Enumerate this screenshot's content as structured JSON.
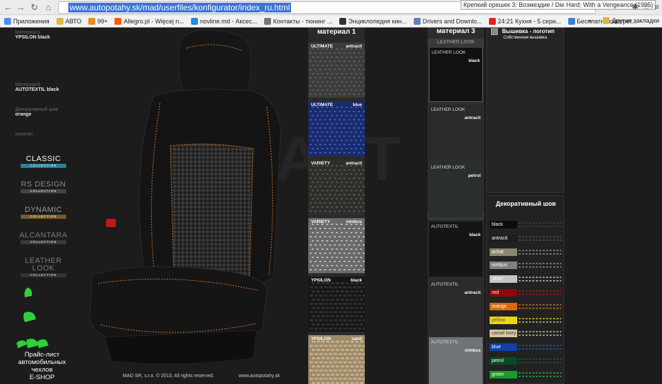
{
  "browser": {
    "url": "www.autopotahy.sk/mad/userfiles/konfigurator/index_ru.html",
    "tooltip": "Крепкий орешек 3: Возмездие / Die Hard: With a Vengeance (1995)",
    "bookmarks": [
      {
        "label": "Приложения",
        "color": "#4a8ef0"
      },
      {
        "label": "АВТО",
        "color": "#e2b640"
      },
      {
        "label": "99+",
        "color": "#f08b1d"
      },
      {
        "label": "Allegro.pl - Więcej n...",
        "color": "#ff5a00"
      },
      {
        "label": "novline.md - Аксес...",
        "color": "#1e88e5"
      },
      {
        "label": "Контакты - тюнинг ...",
        "color": "#777777"
      },
      {
        "label": "Энциклопедия кин...",
        "color": "#333333"
      },
      {
        "label": "Drivers and Downlo...",
        "color": "#5f7fbf"
      },
      {
        "label": "24:21 Кухня - 5 сери...",
        "color": "#e62117"
      },
      {
        "label": "Бесплатно смотрет...",
        "color": "#3a7de0"
      }
    ],
    "bookmarks_more": "»",
    "other_bookmarks": "Другие закладки"
  },
  "left_info": [
    {
      "label": "Материал1",
      "value": "YPSILON black"
    },
    {
      "label": "Материал3",
      "value": "AUTOTEXTIL black"
    },
    {
      "label": "Декоративный шов",
      "value": "orange"
    },
    {
      "label": "логотип",
      "value": ""
    }
  ],
  "collections": [
    {
      "name": "CLASSIC",
      "sub": "COLLECTION",
      "name_color": "#ffffff",
      "bar_color": "#2c7f9a"
    },
    {
      "name": "RS DESIGN",
      "sub": "COLLECTION",
      "name_color": "#8a8a8a",
      "bar_color": "#444444"
    },
    {
      "name": "DYNAMIC",
      "sub": "COLLECTION",
      "name_color": "#9a9a9a",
      "bar_color": "#7a5a2a"
    },
    {
      "name": "ALCANTARA",
      "sub": "COLLECTION",
      "name_color": "#7a7a7a",
      "bar_color": "#3a3a3a"
    },
    {
      "name": "LEATHER LOOK",
      "sub": "COLLECTION",
      "name_color": "#7a7a7a",
      "bar_color": "#333333"
    }
  ],
  "price_link": {
    "line1": "Прайс-лист",
    "line2": "автомобильных",
    "line3": "чехлов",
    "line4": "E-SHOP"
  },
  "footer": {
    "copyright": "MAD SR, s.r.o. © 2013, All rights reserved.",
    "url": "www.autopotahy.sk"
  },
  "material1": {
    "title": "материал 1",
    "swatches": [
      {
        "name": "ULTIMATE",
        "color": "antracit",
        "bg": "#3c3c3c",
        "pattern": "#5a5a5a"
      },
      {
        "name": "ULTIMATE",
        "color": "blue",
        "bg": "#1a2b6e",
        "pattern": "#3a5ab0"
      },
      {
        "name": "VARIETY",
        "color": "antracit",
        "bg": "#2e2e2a",
        "pattern": "#55554a"
      },
      {
        "name": "VARIETY",
        "color": "nimbus",
        "bg": "#6a6a6a",
        "pattern": "#b5b5b5"
      },
      {
        "name": "YPSILON",
        "color": "black",
        "bg": "#161616",
        "pattern": "#2e2e2e"
      },
      {
        "name": "YPSILON",
        "color": "sand",
        "bg": "#9c8a6a",
        "pattern": "#c2ad88"
      }
    ]
  },
  "material3": {
    "title": "материал 3",
    "leather_header": "LEATHER LOOK",
    "autotextil_header": "AUTOTEXTIL",
    "leather": [
      {
        "name": "LEATHER LOOK",
        "color": "black",
        "bg": "#111111"
      },
      {
        "name": "LEATHER LOOK",
        "color": "antracit",
        "bg": "#2a2a2a"
      },
      {
        "name": "LEATHER LOOK",
        "color": "petrol",
        "bg": "#2a2f2c"
      }
    ],
    "autotextil": [
      {
        "name": "AUTOTEXTIL",
        "color": "black",
        "bg": "#151515"
      },
      {
        "name": "AUTOTEXTIL",
        "color": "antracit",
        "bg": "#2b2b2b"
      },
      {
        "name": "AUTOTEXTIL",
        "color": "nimbus",
        "bg": "#6f7276"
      }
    ]
  },
  "logo_option": {
    "title": "Вышивка - логотип",
    "sub": "Собственная вышивка"
  },
  "stitching": {
    "title": "Декоративный шов",
    "items": [
      {
        "label": "black",
        "bg": "#0c0c0c",
        "text": "#ffffff",
        "line": "#444444"
      },
      {
        "label": "antracit",
        "bg": "#1e1e1e",
        "text": "#ffffff",
        "line": "#5a5a5a"
      },
      {
        "label": "achat",
        "bg": "#8a8670",
        "text": "#ffffff",
        "line": "#a8a48a"
      },
      {
        "label": "nimbus",
        "bg": "#808080",
        "text": "#ffffff",
        "line": "#a0a0a0"
      },
      {
        "label": "silver",
        "bg": "#c4c4c4",
        "text": "#ffffff",
        "line": "#dcdcdc"
      },
      {
        "label": "red",
        "bg": "#8a0a0a",
        "text": "#ffffff",
        "line": "#c01818"
      },
      {
        "label": "orange",
        "bg": "#d86a12",
        "text": "#ffffff",
        "line": "#e8801a"
      },
      {
        "label": "yellow",
        "bg": "#e8d812",
        "text": "#555555",
        "line": "#f0e23a"
      },
      {
        "label": "camel ivory",
        "bg": "#d8c8a0",
        "text": "#333333",
        "line": "#e8dcbc"
      },
      {
        "label": "blue",
        "bg": "#1040a8",
        "text": "#ffffff",
        "line": "#2a5ed0"
      },
      {
        "label": "petrol",
        "bg": "#0a4a24",
        "text": "#ffffff",
        "line": "#1a6a3a"
      },
      {
        "label": "green",
        "bg": "#1a9a2a",
        "text": "#ffffff",
        "line": "#3ac04a"
      }
    ]
  },
  "colors": {
    "accent_orange_stitch": "#d8782a",
    "seat_body": "#141414"
  }
}
